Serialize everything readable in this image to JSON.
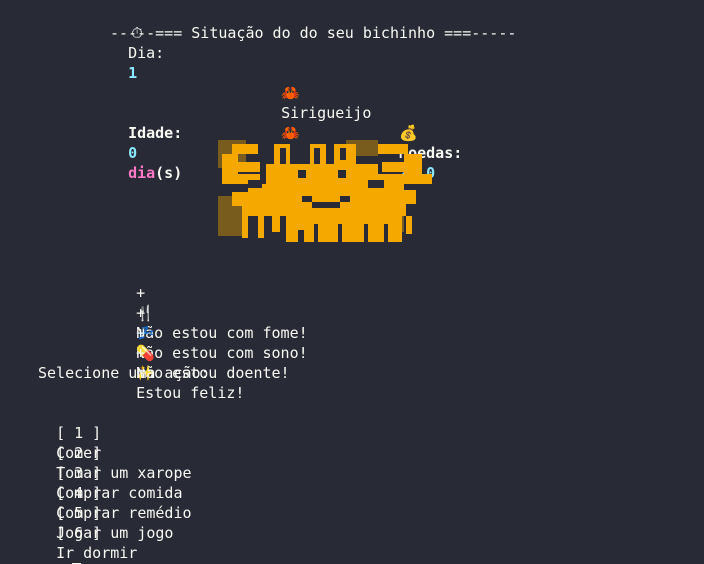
{
  "colors": {
    "background": "#282a36",
    "text": "#f8f8f2",
    "value_cyan": "#8be9fd",
    "unit_pink": "#ff79c6",
    "sprite_orange": "#f5a800"
  },
  "header": {
    "day_icon": "stopwatch-icon",
    "day_label": "Dia:",
    "day_value": "1",
    "status_title": "-----=== Situação do do seu bichinho ===-----"
  },
  "pet": {
    "name_icon": "crab-icon",
    "name": "Sirigueijo",
    "age_label": "Idade:",
    "age_value": "0",
    "age_unit": "dia",
    "age_suffix": "(s)",
    "coins_icon": "money-bag-icon",
    "coins_label": "Moedas:",
    "coins_value": "21.0"
  },
  "status": [
    {
      "bullet": "+",
      "icon": "fork-knife-icon",
      "glyph": "🍴",
      "text": "Não estou com fome!"
    },
    {
      "bullet": "+",
      "icon": "sleeping-zzz-icon",
      "glyph": "💤",
      "text": "Não estou com sono!"
    },
    {
      "bullet": "+",
      "icon": "pill-icon",
      "glyph": "💊",
      "text": "Não estou doente!"
    },
    {
      "bullet": "+",
      "icon": "sparkles-icon",
      "glyph": "✨",
      "text": "Estou feliz!"
    }
  ],
  "menu": {
    "prompt": "Selecione uma ação:",
    "options": [
      {
        "key": "[ 1 ]",
        "label": "Comer"
      },
      {
        "key": "[ 2 ]",
        "label": "Tomar um xarope"
      },
      {
        "key": "[ 3 ]",
        "label": "Comprar comida"
      },
      {
        "key": "[ 4 ]",
        "label": "Comprar remédio"
      },
      {
        "key": "[ 5 ]",
        "label": "Jogar um jogo"
      },
      {
        "key": "[ 6 ]",
        "label": "Ir dormir"
      }
    ],
    "input_prefix": "["
  }
}
